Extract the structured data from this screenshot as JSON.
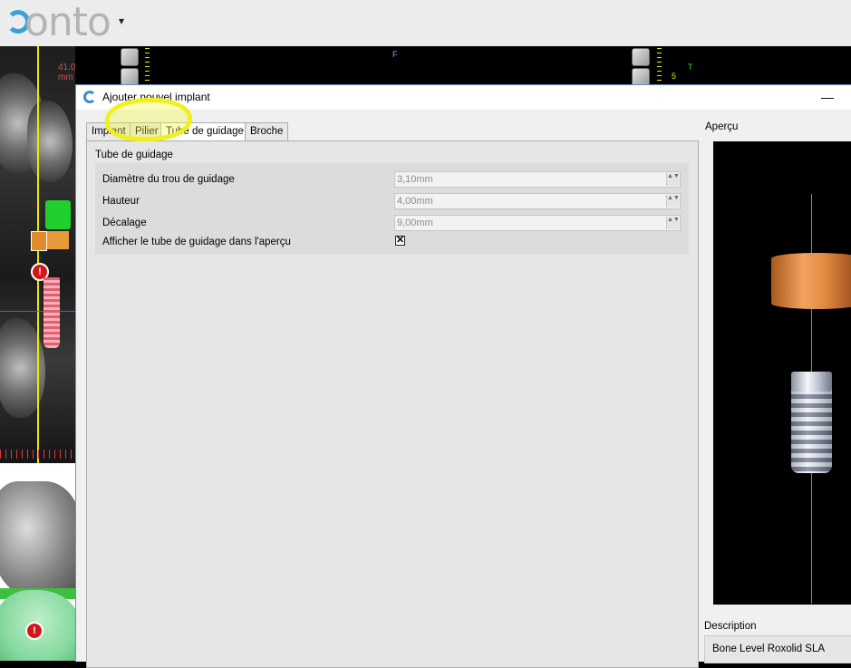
{
  "app": {
    "logo_text": "onto",
    "menu_arrow": "▾"
  },
  "ct_view": {
    "measurement": "41.0 mm",
    "warning_glyph": "!"
  },
  "model_view": {
    "warning_glyph": "!"
  },
  "top_strip": {
    "label_f": "F",
    "label_t": "T",
    "label_5": "5"
  },
  "dialog": {
    "title": "Ajouter nouvel implant",
    "minimize_glyph": "—",
    "tabs": [
      {
        "label": "Implant",
        "active": false
      },
      {
        "label": "Pilier",
        "active": false
      },
      {
        "label": "Tube de guidage",
        "active": true
      },
      {
        "label": "Broche",
        "active": false
      }
    ],
    "group_title": "Tube de guidage",
    "fields": {
      "diameter": {
        "label": "Diamètre du trou de guidage",
        "value": "3,10mm"
      },
      "height": {
        "label": "Hauteur",
        "value": "4,00mm"
      },
      "offset": {
        "label": "Décalage",
        "value": "9,00mm"
      },
      "show_in_preview": {
        "label": "Afficher le tube de guidage dans l'aperçu",
        "checked": true
      }
    },
    "spin_glyph": "▲▼",
    "check_glyph": "✕",
    "preview_label": "Aperçu",
    "description_label": "Description",
    "description_value": "Bone Level  Roxolid SLA"
  },
  "colors": {
    "highlight": "#f0f020",
    "guide_tube": "#e08a40",
    "implant": "#c0c8d4",
    "ct_crosshair_vertical": "#e8e800",
    "ct_crosshair_horizontal": "#2d6bd6"
  }
}
